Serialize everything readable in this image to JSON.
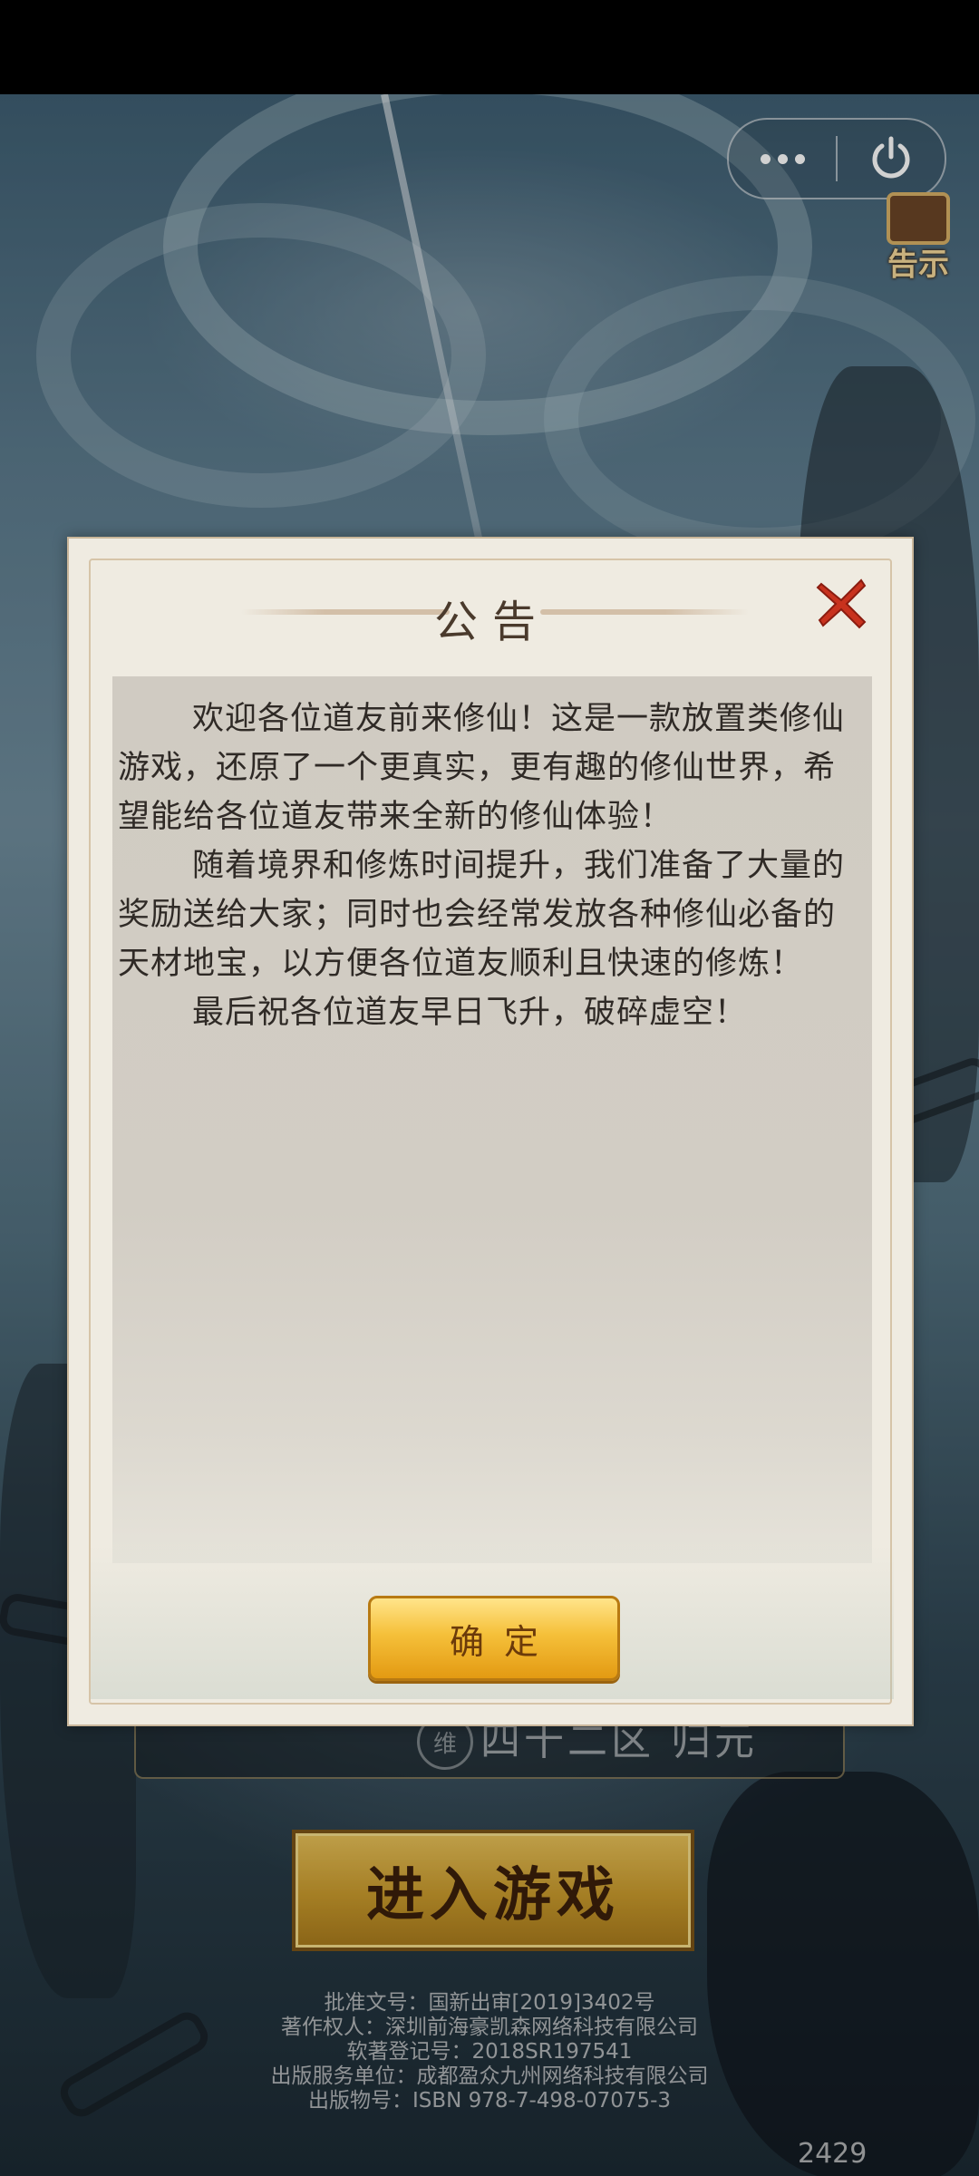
{
  "capsule": {
    "more_icon": "more-dots-icon",
    "power_icon": "power-icon"
  },
  "notice_icon": {
    "label": "告示"
  },
  "server": {
    "icon_text": "维",
    "name": "四十二区 归元"
  },
  "enter_button": {
    "label": "进入游戏"
  },
  "credits": {
    "lines": [
      "批准文号：国新出审[2019]3402号",
      "著作权人：深圳前海豪凯森网络科技有限公司",
      "软著登记号：2018SR197541",
      "出版服务单位：成都盈众九州网络科技有限公司",
      "出版物号：ISBN 978-7-498-07075-3"
    ]
  },
  "version": "2429",
  "dialog": {
    "title": "公告",
    "close_icon": "close-x-icon",
    "paragraphs": [
      "欢迎各位道友前来修仙！这是一款放置类修仙游戏，还原了一个更真实，更有趣的修仙世界，希望能给各位道友带来全新的修仙体验！",
      "随着境界和修炼时间提升，我们准备了大量的奖励送给大家；同时也会经常发放各种修仙必备的天材地宝，以方便各位道友顺利且快速的修炼！",
      "最后祝各位道友早日飞升，破碎虚空！"
    ],
    "confirm_label": "确定"
  },
  "colors": {
    "dialog_bg": "#efebe1",
    "content_bg": "#d0cbc2",
    "button_gold": "#f5c03a",
    "close_red": "#c8321e"
  }
}
